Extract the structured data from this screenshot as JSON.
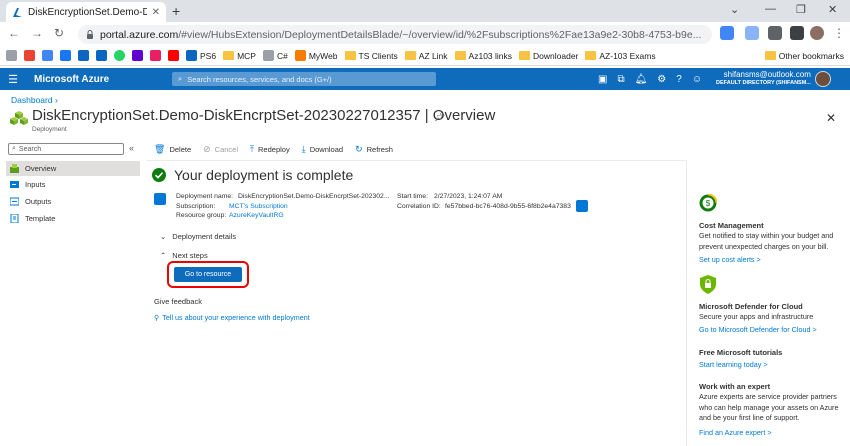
{
  "browser": {
    "tab_title": "DiskEncryptionSet.Demo-DiskEncrptSet...",
    "url_host": "portal.azure.com",
    "url_path": "/#view/HubsExtension/DeploymentDetailsBlade/~/overview/id/%2Fsubscriptions%2Fae13a9e2-30b8-4753-b9e...",
    "bookmarks": [
      "PS6",
      "MCP",
      "C#",
      "MyWeb",
      "TS Clients",
      "AZ Link",
      "Az103 links",
      "Downloader",
      "AZ-103 Exams"
    ],
    "other_bookmarks": "Other bookmarks"
  },
  "azure": {
    "brand": "Microsoft Azure",
    "search_placeholder": "Search resources, services, and docs (G+/)",
    "account_email": "shifansms@outlook.com",
    "account_directory": "DEFAULT DIRECTORY (SHIFANSM..."
  },
  "page": {
    "breadcrumb": "Dashboard",
    "title": "DiskEncryptionSet.Demo-DiskEncrptSet-20230227012357 | Overview",
    "subtitle": "Deployment"
  },
  "nav": {
    "search_placeholder": "Search",
    "items": [
      "Overview",
      "Inputs",
      "Outputs",
      "Template"
    ]
  },
  "commands": {
    "delete": "Delete",
    "cancel": "Cancel",
    "redeploy": "Redeploy",
    "download": "Download",
    "refresh": "Refresh"
  },
  "deployment": {
    "status": "Your deployment is complete",
    "name_label": "Deployment name:",
    "name_value": "DiskEncryptionSet.Demo-DiskEncrptSet-202302...",
    "subscription_label": "Subscription:",
    "subscription_value": "MCT's Subscription",
    "rg_label": "Resource group:",
    "rg_value": "AzureKeyVaultRG",
    "start_label": "Start time:",
    "start_value": "2/27/2023, 1:24:07 AM",
    "corr_label": "Correlation ID:",
    "corr_value": "fe57bbed-bc76-408d-9b55-6f8b2e4a7383",
    "details": "Deployment details",
    "next_steps": "Next steps",
    "go_button": "Go to resource",
    "feedback_heading": "Give feedback",
    "feedback_link": "Tell us about your experience with deployment"
  },
  "right_panel": {
    "cost": {
      "heading": "Cost Management",
      "text1": "Get notified to stay within your budget and",
      "text2": "prevent unexpected charges on your bill.",
      "link": "Set up cost alerts >"
    },
    "defender": {
      "heading": "Microsoft Defender for Cloud",
      "text1": "Secure your apps and infrastructure",
      "link": "Go to Microsoft Defender for Cloud >"
    },
    "tutorials": {
      "heading": "Free Microsoft tutorials",
      "link": "Start learning today >"
    },
    "expert": {
      "heading": "Work with an expert",
      "text1": "Azure experts are service provider partners",
      "text2": "who can help manage your assets on Azure",
      "text3": "and be your first line of support.",
      "link": "Find an Azure expert >"
    }
  },
  "colors": {
    "azure_blue": "#0f6cbd",
    "link_blue": "#0078d4",
    "success_green": "#107c10",
    "highlight_red": "#ee0000"
  }
}
